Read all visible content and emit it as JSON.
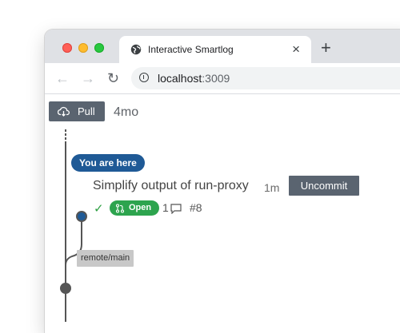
{
  "tab": {
    "title": "Interactive Smartlog",
    "close": "×",
    "new_tab": "+"
  },
  "toolbar": {
    "back": "←",
    "forward": "→",
    "reload": "↻",
    "url_host": "localhost",
    "url_port": ":3009"
  },
  "smartlog": {
    "pull_label": "Pull",
    "pull_age": "4mo",
    "here_badge": "You are here",
    "commit": {
      "title": "Simplify output of run-proxy",
      "age": "1m",
      "uncommit_label": "Uncommit",
      "check": "✓",
      "pr_status": "Open",
      "comment_count": "1",
      "pr_number": "#8"
    },
    "remote_bookmark": "remote/main"
  },
  "colors": {
    "here_badge": "#1f5a96",
    "open_badge": "#2da44e",
    "button": "#5a6470",
    "graph_line": "#555555"
  }
}
